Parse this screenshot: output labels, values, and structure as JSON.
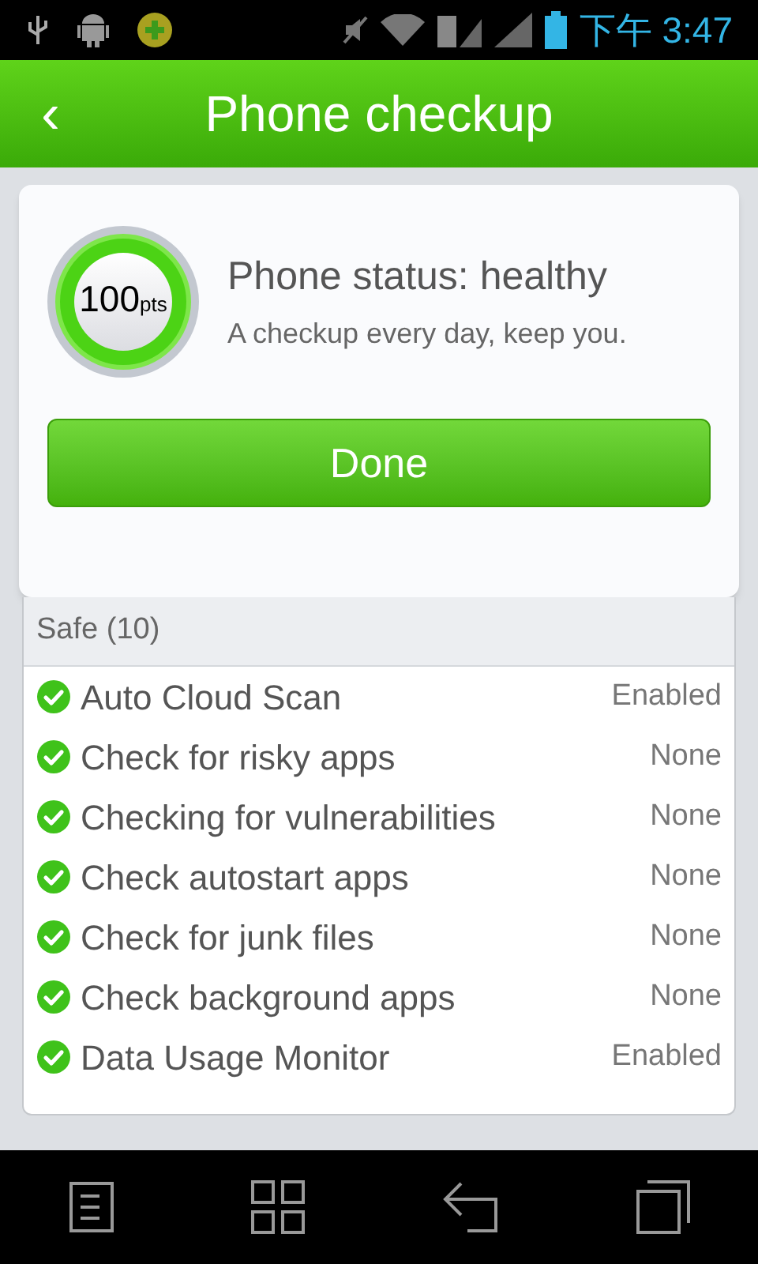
{
  "status_bar": {
    "time": "下午 3:47"
  },
  "header": {
    "back": "‹",
    "title": "Phone checkup"
  },
  "score": {
    "value": "100",
    "unit": "pts"
  },
  "status": {
    "title": "Phone status: healthy",
    "subtitle": "A checkup every day, keep you."
  },
  "done_button": "Done",
  "section": {
    "title": "Safe (10)"
  },
  "items": [
    {
      "name": "Auto Cloud Scan",
      "result": "Enabled",
      "checked": true
    },
    {
      "name": "Check for risky apps",
      "result": "None",
      "checked": true
    },
    {
      "name": "Checking for vulnerabilities",
      "result": "None",
      "checked": true
    },
    {
      "name": "Check autostart apps",
      "result": "None",
      "checked": true
    },
    {
      "name": "Check for junk files",
      "result": "None",
      "checked": true
    },
    {
      "name": "Check background apps",
      "result": "None",
      "checked": true
    },
    {
      "name": "Data Usage Monitor",
      "result": "Enabled",
      "checked": true
    }
  ]
}
